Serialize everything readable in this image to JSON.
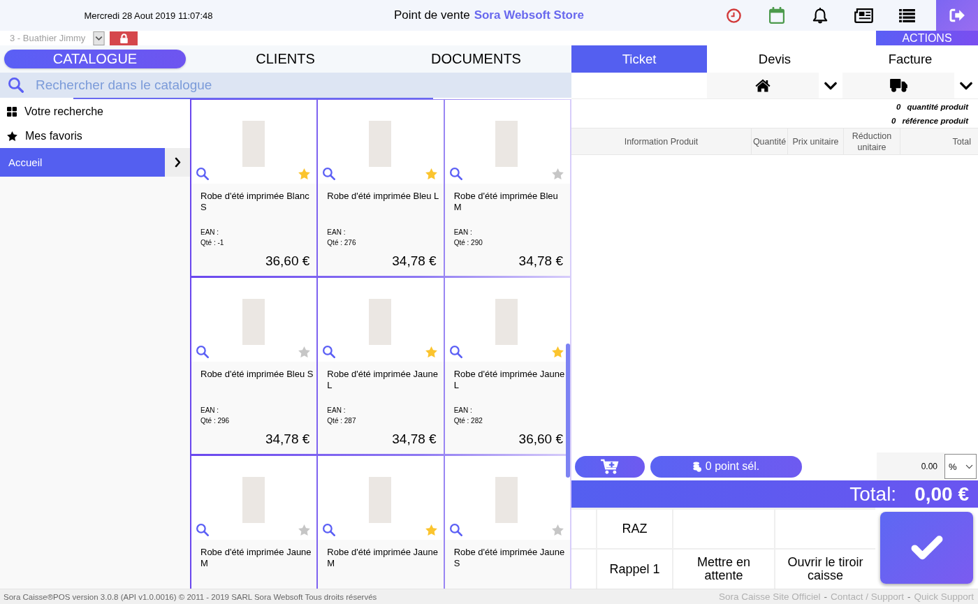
{
  "header": {
    "datetime": "Mercredi 28 Aout 2019 11:07:48",
    "title": "Point de vente",
    "store": "Sora Websoft Store"
  },
  "user_bar": {
    "user": "3 - Buathier Jimmy",
    "actions_label": "ACTIONS"
  },
  "catalog_tabs": [
    {
      "label": "CATALOGUE",
      "selected": true
    },
    {
      "label": "CLIENTS",
      "selected": false
    },
    {
      "label": "DOCUMENTS",
      "selected": false
    }
  ],
  "search": {
    "placeholder": "Rechercher dans le catalogue"
  },
  "sidebar": {
    "items": [
      {
        "kind": "search",
        "label": "Votre recherche",
        "selected": false
      },
      {
        "kind": "favorites",
        "label": "Mes favoris",
        "selected": false
      },
      {
        "kind": "category",
        "label": "Accueil",
        "selected": true
      }
    ]
  },
  "products": [
    {
      "name": "Robe d'été imprimée Blanc S",
      "ean": "EAN :",
      "qty": "Qté : -1",
      "price": "36,60 €",
      "favorite": true
    },
    {
      "name": "Robe d'été imprimée Bleu L",
      "ean": "EAN :",
      "qty": "Qté : 276",
      "price": "34,78 €",
      "favorite": true
    },
    {
      "name": "Robe d'été imprimée Bleu M",
      "ean": "EAN :",
      "qty": "Qté : 290",
      "price": "34,78 €",
      "favorite": false
    },
    {
      "name": "Robe d'été imprimée Bleu S",
      "ean": "EAN :",
      "qty": "Qté : 296",
      "price": "34,78 €",
      "favorite": false
    },
    {
      "name": "Robe d'été imprimée Jaune L",
      "ean": "EAN :",
      "qty": "Qté : 287",
      "price": "34,78 €",
      "favorite": true
    },
    {
      "name": "Robe d'été imprimée Jaune L",
      "ean": "EAN :",
      "qty": "Qté : 282",
      "price": "36,60 €",
      "favorite": true
    },
    {
      "name": "Robe d'été imprimée Jaune M",
      "favorite": false
    },
    {
      "name": "Robe d'été imprimée Jaune M",
      "favorite": true
    },
    {
      "name": "Robe d'été imprimée Jaune S",
      "favorite": false
    }
  ],
  "ticket": {
    "tabs": [
      {
        "label": "Ticket",
        "selected": true
      },
      {
        "label": "Devis",
        "selected": false
      },
      {
        "label": "Facture",
        "selected": false
      }
    ],
    "counters": [
      {
        "value": "0",
        "label": "quantité produit"
      },
      {
        "value": "0",
        "label": "référence produit"
      }
    ],
    "columns": [
      "Information Produit",
      "Quantité",
      "Prix unitaire",
      "Réduction unitaire",
      "Total"
    ],
    "points_button": "0 point sél.",
    "discount": {
      "value": "0.00",
      "unit": "%"
    },
    "total_label": "Total:",
    "total_value": "0,00 €",
    "actions": [
      [
        {
          "kind": "blank"
        },
        {
          "kind": "button",
          "label": "RAZ"
        },
        {
          "kind": "blank"
        },
        {
          "kind": "blank"
        }
      ],
      [
        {
          "kind": "blank"
        },
        {
          "kind": "button",
          "label": "Rappel 1"
        },
        {
          "kind": "button",
          "label": "Mettre en attente"
        },
        {
          "kind": "button",
          "label": "Ouvrir le tiroir caisse"
        }
      ]
    ]
  },
  "footer": {
    "copyright": "Sora Caisse®POS version 3.0.8 (API v1.0.0016) © 2011 - 2019 SARL Sora Websoft Tous droits réservés",
    "links": [
      "Sora Caisse Site Officiel",
      "Contact / Support",
      "Quick Support"
    ],
    "separator": "-"
  }
}
